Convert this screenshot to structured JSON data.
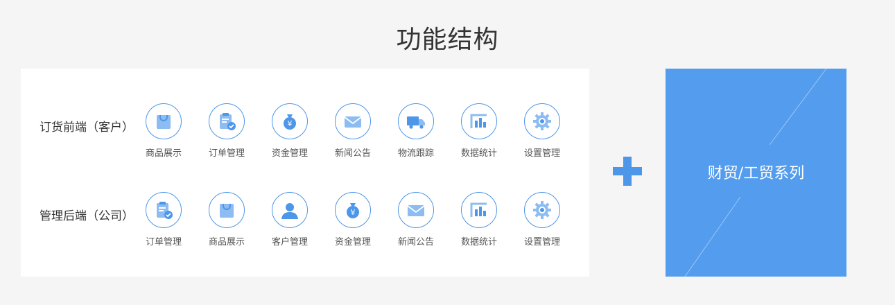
{
  "page": {
    "title": "功能结构"
  },
  "rows": [
    {
      "label": "订货前端（客户）",
      "items": [
        {
          "label": "商品展示",
          "icon": "shopping-bag-icon"
        },
        {
          "label": "订单管理",
          "icon": "clipboard-check-icon"
        },
        {
          "label": "资金管理",
          "icon": "money-bag-icon"
        },
        {
          "label": "新闻公告",
          "icon": "envelope-icon"
        },
        {
          "label": "物流跟踪",
          "icon": "truck-icon"
        },
        {
          "label": "数据统计",
          "icon": "bar-chart-icon"
        },
        {
          "label": "设置管理",
          "icon": "gear-icon"
        }
      ]
    },
    {
      "label": "管理后端（公司）",
      "items": [
        {
          "label": "订单管理",
          "icon": "clipboard-check-icon"
        },
        {
          "label": "商品展示",
          "icon": "shopping-bag-icon"
        },
        {
          "label": "客户管理",
          "icon": "user-icon"
        },
        {
          "label": "资金管理",
          "icon": "money-bag-icon"
        },
        {
          "label": "新闻公告",
          "icon": "envelope-icon"
        },
        {
          "label": "数据统计",
          "icon": "bar-chart-icon"
        },
        {
          "label": "设置管理",
          "icon": "gear-icon"
        }
      ]
    }
  ],
  "series": {
    "label": "财贸/工贸系列"
  },
  "colors": {
    "accent": "#4d96e8",
    "card": "#539cee",
    "icon_fill": "#8cbcf2"
  }
}
